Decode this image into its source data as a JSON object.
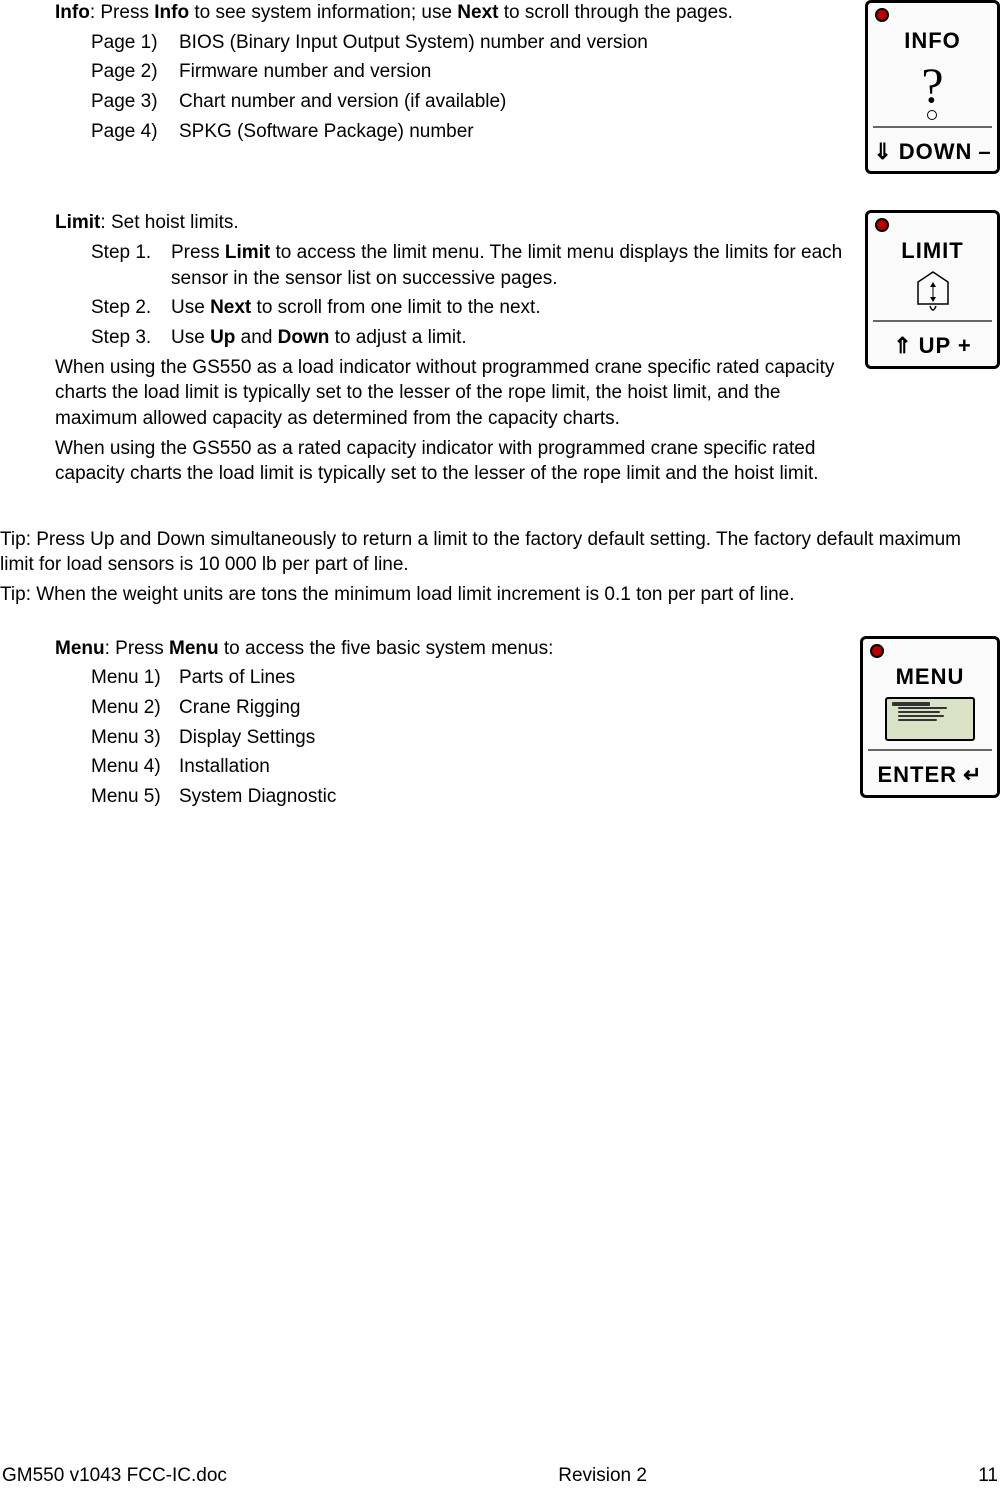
{
  "info": {
    "title": "Info",
    "intro_a": ": Press ",
    "intro_b": "Info",
    "intro_c": " to see system information; use ",
    "intro_d": "Next",
    "intro_e": " to scroll through the pages.",
    "pages": [
      {
        "label": "Page 1)",
        "text": "BIOS (Binary Input Output System) number and version"
      },
      {
        "label": "Page 2)",
        "text": "Firmware number and version"
      },
      {
        "label": "Page 3)",
        "text": "Chart number and version (if available)"
      },
      {
        "label": "Page 4)",
        "text": "SPKG (Software Package) number"
      }
    ],
    "fig": {
      "top": "INFO",
      "bottom_pre": "DOWN",
      "bottom_suf": "–"
    }
  },
  "limit": {
    "title": "Limit",
    "intro": ": Set hoist limits.",
    "steps": [
      {
        "label": "Step 1.",
        "pre": "Press ",
        "b1": "Limit",
        "post": " to access the limit menu. The limit menu displays the limits for each sensor in the sensor list on successive pages."
      },
      {
        "label": "Step 2.",
        "pre": "Use ",
        "b1": "Next",
        "post": " to scroll from one limit to the next."
      },
      {
        "label": "Step 3.",
        "pre": "Use ",
        "b1": "Up",
        "mid": " and ",
        "b2": "Down",
        "post": " to adjust a limit."
      }
    ],
    "para1": "When using the GS550 as a load indicator without programmed crane specific rated capacity charts the load limit is typically set to the lesser of the rope limit, the hoist limit, and the maximum allowed capacity as determined from the capacity charts.",
    "para2": "When using the GS550 as a rated capacity indicator with programmed crane specific rated capacity charts the load limit is typically set to the lesser of the rope limit and the hoist limit.",
    "fig": {
      "top": "LIMIT",
      "bottom": "UP  +"
    }
  },
  "tips": {
    "t1": "Tip: Press Up and Down simultaneously to return a limit to the factory default setting. The factory default maximum limit for load sensors is 10 000 lb per part of line.",
    "t2": "Tip: When the weight units are tons the minimum load limit increment is 0.1 ton per part of line."
  },
  "menu": {
    "title": "Menu",
    "intro_a": ": Press ",
    "intro_b": "Menu",
    "intro_c": " to access the five basic system menus:",
    "items": [
      {
        "label": "Menu 1)",
        "text": "Parts of Lines"
      },
      {
        "label": "Menu 2)",
        "text": "Crane Rigging"
      },
      {
        "label": "Menu 3)",
        "text": "Display Settings"
      },
      {
        "label": "Menu 4)",
        "text": "Installation"
      },
      {
        "label": "Menu 5)",
        "text": "System Diagnostic"
      }
    ],
    "fig": {
      "top": "MENU",
      "bottom": "ENTER"
    }
  },
  "footer": {
    "left": "GM550 v1043 FCC-IC.doc",
    "center": "Revision 2",
    "right": "11"
  }
}
